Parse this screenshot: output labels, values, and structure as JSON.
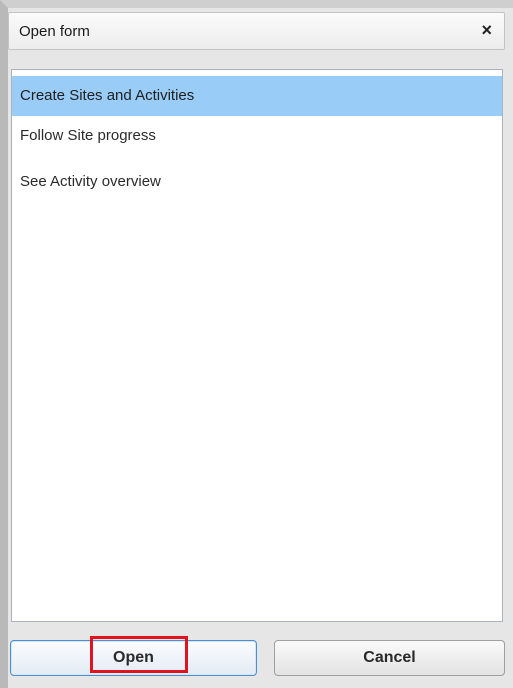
{
  "dialog": {
    "title": "Open form",
    "close_glyph": "×",
    "items": [
      {
        "label": "Create Sites and Activities",
        "selected": true
      },
      {
        "label": "Follow Site progress",
        "selected": false
      },
      {
        "label": "See Activity overview",
        "selected": false
      }
    ],
    "open_label": "Open",
    "cancel_label": "Cancel"
  },
  "colors": {
    "selection": "#99ccf7",
    "highlight_outline": "#e0141e",
    "focus_border": "#4c8fd1"
  }
}
